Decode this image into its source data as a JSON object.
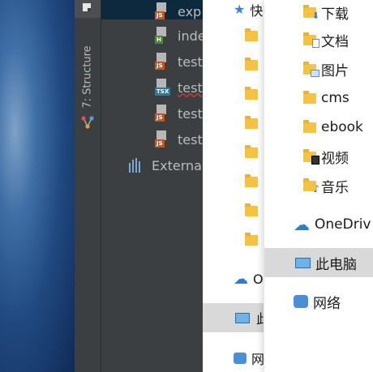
{
  "ide": {
    "structure_label": "7: Structure",
    "files": [
      {
        "name": "exp",
        "tag": "JS",
        "tag_color": "#c2561e"
      },
      {
        "name": "inde",
        "tag": "H",
        "tag_color": "#4d8a2b"
      },
      {
        "name": "test",
        "tag": "JS",
        "tag_color": "#c2561e"
      },
      {
        "name": "test",
        "tag": "TSX",
        "tag_color": "#2a7b9e"
      },
      {
        "name": "test",
        "tag": "JS",
        "tag_color": "#c2561e"
      },
      {
        "name": "test",
        "tag": "JS",
        "tag_color": "#c2561e"
      }
    ],
    "external_label": "Externa"
  },
  "explorer_back": {
    "quick_access_initial": "快",
    "onedrive_initial": "O",
    "this_pc_initial": "此",
    "network_initial": "网"
  },
  "explorer_front": {
    "items": [
      {
        "label": "下载",
        "icon": "downloads-folder-icon"
      },
      {
        "label": "文档",
        "icon": "documents-folder-icon"
      },
      {
        "label": "图片",
        "icon": "pictures-folder-icon"
      },
      {
        "label": "cms",
        "icon": "folder-icon"
      },
      {
        "label": "ebook",
        "icon": "folder-icon"
      },
      {
        "label": "视频",
        "icon": "videos-folder-icon"
      },
      {
        "label": "音乐",
        "icon": "music-folder-icon"
      }
    ],
    "onedrive": "OneDriv",
    "this_pc": "此电脑",
    "network": "网络"
  },
  "colors": {
    "ide_bg": "#3c3f41",
    "selection": "#0d293e",
    "explorer_hl": "#d9d9d9",
    "folder": "#f5c243"
  }
}
